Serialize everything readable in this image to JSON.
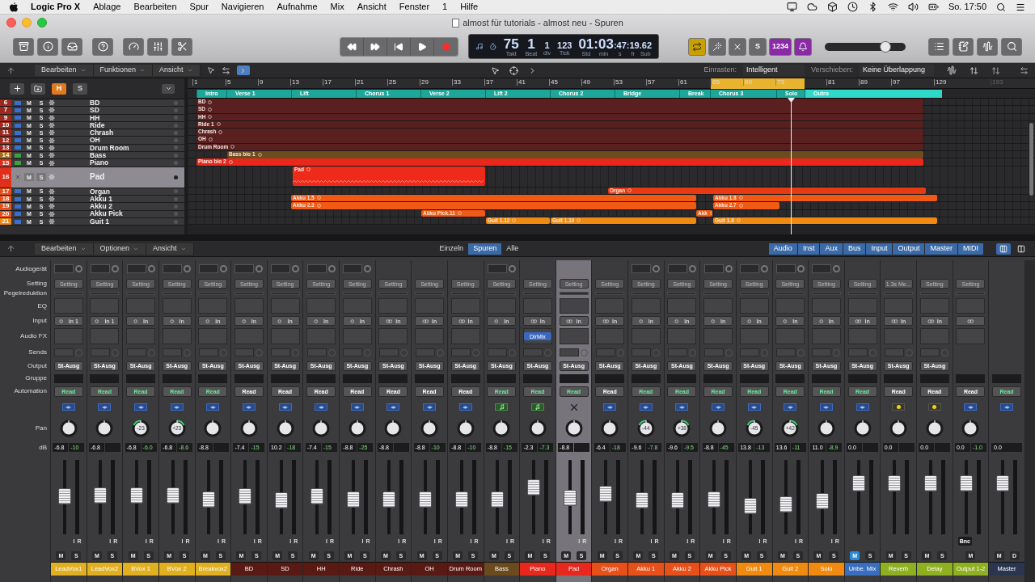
{
  "menu_bar": {
    "app": "Logic Pro X",
    "items": [
      "Ablage",
      "Bearbeiten",
      "Spur",
      "Navigieren",
      "Aufnahme",
      "Mix",
      "Ansicht",
      "Fenster",
      "1",
      "Hilfe"
    ],
    "clock": "So. 17:50"
  },
  "window": {
    "title": "almost für tutorials - almost neu - Spuren"
  },
  "toolbar": {
    "lcd": {
      "fields": [
        {
          "value": "75",
          "label": "Takt",
          "kind": "large"
        },
        {
          "value": "1",
          "label": "Beat",
          "kind": "large"
        },
        {
          "value": "1",
          "label": "div",
          "kind": "small"
        },
        {
          "value": "123",
          "label": "Tick",
          "kind": "small"
        }
      ],
      "time": [
        {
          "value": "01",
          "label": "Std",
          "kind": "large"
        },
        {
          "value": ":03",
          "label": "min",
          "kind": "large"
        },
        {
          "value": ":47",
          "label": "s",
          "kind": "small"
        },
        {
          "value": ":19",
          "label": "fr",
          "kind": "small"
        },
        {
          "value": ".62",
          "label": "Sub",
          "kind": "small"
        }
      ]
    },
    "modes": [
      {
        "kind": "cycle",
        "on": true
      },
      {
        "kind": "tuner",
        "on": false
      },
      {
        "kind": "replace",
        "on": false
      },
      {
        "kind": "solo",
        "label": "S",
        "on": false
      },
      {
        "kind": "count-in",
        "label": "1234",
        "on": true
      },
      {
        "kind": "metronome",
        "on": true
      }
    ],
    "master_volume": {
      "level": 0.75
    }
  },
  "tracks_bar": {
    "menus": [
      "Bearbeiten",
      "Funktionen",
      "Ansicht"
    ],
    "snap": {
      "label": "Einrasten:",
      "value": "Intelligent"
    },
    "drag": {
      "label": "Verschieben:",
      "value": "Keine Überlappung"
    }
  },
  "track_header_buttons": [
    {
      "label": "H",
      "on": true
    },
    {
      "label": "S",
      "on": false
    }
  ],
  "ruler": {
    "cycle_on": true,
    "ticks": [
      {
        "label": "1",
        "dimmed": false
      },
      {
        "label": "5",
        "dimmed": false
      },
      {
        "label": "9",
        "dimmed": false
      },
      {
        "label": "13",
        "dimmed": false
      },
      {
        "label": "17",
        "dimmed": false
      },
      {
        "label": "21",
        "dimmed": false
      },
      {
        "label": "25",
        "dimmed": false
      },
      {
        "label": "29",
        "dimmed": false
      },
      {
        "label": "33",
        "dimmed": false
      },
      {
        "label": "37",
        "dimmed": false
      },
      {
        "label": "41",
        "dimmed": false
      },
      {
        "label": "45",
        "dimmed": false
      },
      {
        "label": "49",
        "dimmed": false
      },
      {
        "label": "53",
        "dimmed": false
      },
      {
        "label": "57",
        "dimmed": false
      },
      {
        "label": "61",
        "dimmed": false
      },
      {
        "label": "65",
        "dimmed": false
      },
      {
        "label": "69",
        "dimmed": false
      },
      {
        "label": "73",
        "dimmed": false
      },
      {
        "label": "81",
        "dimmed": false
      },
      {
        "label": "89",
        "dimmed": false
      },
      {
        "label": "97",
        "dimmed": false
      },
      {
        "label": "129",
        "dimmed": false
      },
      {
        "label": "193",
        "dimmed": true
      }
    ]
  },
  "markers": [
    {
      "label": "Intro",
      "selected": false
    },
    {
      "label": "Verse 1",
      "selected": false
    },
    {
      "label": "Lift",
      "selected": false
    },
    {
      "label": "Chorus 1",
      "selected": false
    },
    {
      "label": "Verse 2",
      "selected": false
    },
    {
      "label": "Lift 2",
      "selected": false
    },
    {
      "label": "Chorus 2",
      "selected": false
    },
    {
      "label": "Bridge",
      "selected": false
    },
    {
      "label": "Break",
      "selected": false
    },
    {
      "label": "Chorus 3",
      "selected": false
    },
    {
      "label": "Solo",
      "selected": false
    },
    {
      "label": "Outro",
      "selected": true
    }
  ],
  "tracks": [
    {
      "number": "6",
      "name": "BD",
      "color": "#9c2a1e",
      "kind": "audio",
      "mute": "M",
      "solo": "S",
      "selected": false,
      "regions": [
        {
          "name": "BD",
          "color": "#5a2020"
        }
      ]
    },
    {
      "number": "7",
      "name": "SD",
      "color": "#9c2a1e",
      "kind": "audio",
      "mute": "M",
      "solo": "S",
      "selected": false,
      "regions": [
        {
          "name": "SD",
          "color": "#5a2020"
        }
      ]
    },
    {
      "number": "9",
      "name": "HH",
      "color": "#9c2a1e",
      "kind": "audio",
      "mute": "M",
      "solo": "S",
      "selected": false,
      "regions": [
        {
          "name": "HH",
          "color": "#5a2020"
        }
      ]
    },
    {
      "number": "10",
      "name": "Ride",
      "color": "#9c2a1e",
      "kind": "audio",
      "mute": "M",
      "solo": "S",
      "selected": false,
      "regions": [
        {
          "name": "Ride 1",
          "color": "#5a2020"
        }
      ]
    },
    {
      "number": "11",
      "name": "Chrash",
      "color": "#9c2a1e",
      "kind": "audio",
      "mute": "M",
      "solo": "S",
      "selected": false,
      "regions": [
        {
          "name": "Chrash",
          "color": "#5a2020"
        }
      ]
    },
    {
      "number": "12",
      "name": "OH",
      "color": "#9c2a1e",
      "kind": "audio",
      "mute": "M",
      "solo": "S",
      "selected": false,
      "regions": [
        {
          "name": "OH",
          "color": "#5a2020"
        }
      ]
    },
    {
      "number": "13",
      "name": "Drum Room",
      "color": "#9c2a1e",
      "kind": "audio",
      "mute": "M",
      "solo": "S",
      "selected": false,
      "regions": [
        {
          "name": "Drum Room",
          "color": "#5a2020"
        }
      ]
    },
    {
      "number": "14",
      "name": "Bass",
      "color": "#a8681c",
      "kind": "midi",
      "mute": "M",
      "solo": "S",
      "selected": false,
      "regions": [
        {
          "name": "Bass bio 1",
          "color": "#6e4c1e"
        }
      ]
    },
    {
      "number": "15",
      "name": "Piano",
      "color": "#e0301c",
      "kind": "midi",
      "mute": "M",
      "solo": "S",
      "selected": false,
      "regions": [
        {
          "name": "Piano bio 2",
          "color": "#e8281c"
        }
      ]
    },
    {
      "number": "16",
      "name": "Pad",
      "color": "#e0301c",
      "kind": "inst",
      "mute": "M",
      "solo": "S",
      "selected": true,
      "regions": [
        {
          "name": "Pad",
          "color": "#f02a1a"
        }
      ]
    },
    {
      "number": "17",
      "name": "Organ",
      "color": "#e6501a",
      "kind": "audio",
      "mute": "M",
      "solo": "S",
      "selected": false,
      "regions": [
        {
          "name": "Organ",
          "color": "#e83a12"
        }
      ]
    },
    {
      "number": "18",
      "name": "Akku 1",
      "color": "#e6501a",
      "kind": "audio",
      "mute": "M",
      "solo": "S",
      "selected": false,
      "regions": [
        {
          "name": "Akku 1.5",
          "color": "#f05a14"
        },
        {
          "name": "Akku 1.8",
          "color": "#f05a14"
        }
      ]
    },
    {
      "number": "19",
      "name": "Akku 2",
      "color": "#e6501a",
      "kind": "audio",
      "mute": "M",
      "solo": "S",
      "selected": false,
      "regions": [
        {
          "name": "Akku 2.3",
          "color": "#f05a14"
        },
        {
          "name": "Akku 2.7",
          "color": "#f05a14"
        }
      ]
    },
    {
      "number": "20",
      "name": "Akku Pick",
      "color": "#e6501a",
      "kind": "audio",
      "mute": "M",
      "solo": "S",
      "selected": false,
      "regions": [
        {
          "name": "Akku Pick.11",
          "color": "#f05a14"
        },
        {
          "name": "Akk",
          "color": "#f05a14"
        }
      ]
    },
    {
      "number": "21",
      "name": "Guit 1",
      "color": "#f08a10",
      "kind": "audio",
      "mute": "M",
      "solo": "S",
      "selected": false,
      "regions": [
        {
          "name": "Guit 1.12",
          "color": "#f08a10"
        },
        {
          "name": "Guit 1.10",
          "color": "#f08a10"
        },
        {
          "name": "Guit 1.8",
          "color": "#f08a10"
        }
      ]
    }
  ],
  "mixer": {
    "menus": [
      "Bearbeiten",
      "Optionen",
      "Ansicht"
    ],
    "scope_tabs": [
      {
        "label": "Einzeln",
        "selected": false
      },
      {
        "label": "Spuren",
        "selected": true
      },
      {
        "label": "Alle",
        "selected": false
      }
    ],
    "filters": [
      {
        "label": "Audio",
        "on": true
      },
      {
        "label": "Inst",
        "on": true
      },
      {
        "label": "Aux",
        "on": true
      },
      {
        "label": "Bus",
        "on": true
      },
      {
        "label": "Input",
        "on": true
      },
      {
        "label": "Output",
        "on": true
      },
      {
        "label": "Master",
        "on": true
      },
      {
        "label": "MIDI",
        "on": true
      }
    ],
    "views": [
      {
        "kind": "strips",
        "selected": true
      },
      {
        "kind": "split",
        "selected": false
      }
    ],
    "row_labels": [
      {
        "kind": "device",
        "text": "Audiogerät"
      },
      {
        "kind": "setting",
        "text": "Setting"
      },
      {
        "kind": "pegel",
        "text": "Pegelreduktion"
      },
      {
        "kind": "eq",
        "text": "EQ"
      },
      {
        "kind": "input",
        "text": "Input"
      },
      {
        "kind": "fx",
        "text": "Audio FX"
      },
      {
        "kind": "sends",
        "text": "Sends"
      },
      {
        "kind": "output",
        "text": "Output"
      },
      {
        "kind": "group",
        "text": "Gruppe"
      },
      {
        "kind": "automation",
        "text": "Automation"
      },
      {
        "kind": "pan",
        "text": "Pan"
      },
      {
        "kind": "db",
        "text": "dB"
      }
    ],
    "strips": [
      {
        "name": "LeadVox1",
        "color": "#e0b020",
        "device": true,
        "kind": "audio",
        "setting": "Setting",
        "stereo": false,
        "input": "In 1",
        "output": "St-Ausg",
        "automation": "Read",
        "automation_on": true,
        "pan_knob": true,
        "volume": "-6.8",
        "peak": "-10",
        "level": 0.52,
        "ir": [
          "I",
          "R"
        ],
        "buttons": [
          {
            "label": "M",
            "on": false
          },
          {
            "label": "S",
            "on": false
          }
        ],
        "selected": false
      },
      {
        "name": "LeadVox2",
        "color": "#e0b020",
        "device": true,
        "kind": "audio",
        "setting": "Setting",
        "stereo": false,
        "input": "In 1",
        "output": "St-Ausg",
        "automation": "Read",
        "automation_on": true,
        "pan_knob": true,
        "volume": "-6.8",
        "level": 0.53,
        "ir": [
          "I",
          "R"
        ],
        "buttons": [
          {
            "label": "M",
            "on": false
          },
          {
            "label": "S",
            "on": false
          }
        ],
        "selected": false
      },
      {
        "name": "BVox 1",
        "color": "#e0b020",
        "device": true,
        "kind": "audio",
        "setting": "Setting",
        "stereo": false,
        "input": "In",
        "output": "St-Ausg",
        "automation": "Read",
        "automation_on": true,
        "pan_knob": true,
        "pan": "-23",
        "pan_right": false,
        "volume": "-6.8",
        "peak": "-6.0",
        "level": 0.53,
        "ir": [
          "I",
          "R"
        ],
        "buttons": [
          {
            "label": "M",
            "on": false
          },
          {
            "label": "S",
            "on": false
          }
        ],
        "selected": false
      },
      {
        "name": "BVox 2",
        "color": "#e0b020",
        "device": true,
        "kind": "audio",
        "setting": "Setting",
        "stereo": false,
        "input": "In",
        "output": "St-Ausg",
        "automation": "Read",
        "automation_on": true,
        "pan_knob": true,
        "pan": "+23",
        "pan_right": true,
        "volume": "-6.8",
        "peak": "-8.6",
        "level": 0.53,
        "ir": [
          "I",
          "R"
        ],
        "buttons": [
          {
            "label": "M",
            "on": false
          },
          {
            "label": "S",
            "on": false
          }
        ],
        "selected": false
      },
      {
        "name": "Breakvox2",
        "color": "#e0b020",
        "device": true,
        "kind": "audio",
        "setting": "Setting",
        "stereo": false,
        "input": "In",
        "output": "St-Ausg",
        "automation": "Read",
        "automation_on": true,
        "pan_knob": true,
        "volume": "-8.8",
        "level": 0.46,
        "ir": [
          "I",
          "R"
        ],
        "buttons": [
          {
            "label": "M",
            "on": false
          },
          {
            "label": "S",
            "on": false
          }
        ],
        "selected": false
      },
      {
        "name": "BD",
        "color": "#5a1a14",
        "device": true,
        "kind": "audio",
        "setting": "Setting",
        "stereo": false,
        "input": "In",
        "output": "St-Ausg",
        "automation": "Read",
        "automation_on": false,
        "pan_knob": true,
        "volume": "-7.4",
        "peak": "-15",
        "level": 0.52,
        "ir": [
          "I",
          "R"
        ],
        "buttons": [
          {
            "label": "M",
            "on": false
          },
          {
            "label": "S",
            "on": false
          }
        ],
        "selected": false
      },
      {
        "name": "SD",
        "color": "#5a1a14",
        "device": true,
        "kind": "audio",
        "setting": "Setting",
        "stereo": false,
        "input": "In",
        "output": "St-Ausg",
        "automation": "Read",
        "automation_on": false,
        "pan_knob": true,
        "volume": "10.2",
        "peak": "-18",
        "level": 0.44,
        "ir": [
          "I",
          "R"
        ],
        "buttons": [
          {
            "label": "M",
            "on": false
          },
          {
            "label": "S",
            "on": false
          }
        ],
        "selected": false
      },
      {
        "name": "HH",
        "color": "#5a1a14",
        "device": true,
        "kind": "audio",
        "setting": "Setting",
        "stereo": false,
        "input": "In",
        "output": "St-Ausg",
        "automation": "Read",
        "automation_on": false,
        "pan_knob": true,
        "volume": "-7.4",
        "peak": "-15",
        "level": 0.52,
        "ir": [
          "I",
          "R"
        ],
        "buttons": [
          {
            "label": "M",
            "on": false
          },
          {
            "label": "S",
            "on": false
          }
        ],
        "selected": false
      },
      {
        "name": "Ride",
        "color": "#5a1a14",
        "device": true,
        "kind": "audio",
        "setting": "Setting",
        "stereo": false,
        "input": "In",
        "output": "St-Ausg",
        "automation": "Read",
        "automation_on": false,
        "pan_knob": true,
        "volume": "-8.8",
        "peak": "-25",
        "level": 0.46,
        "ir": [
          "I",
          "R"
        ],
        "buttons": [
          {
            "label": "M",
            "on": false
          },
          {
            "label": "S",
            "on": false
          }
        ],
        "selected": false
      },
      {
        "name": "Chrash",
        "color": "#5a1a14",
        "device": false,
        "kind": "audio",
        "setting": "Setting",
        "stereo": true,
        "input": "In",
        "output": "St-Ausg",
        "automation": "Read",
        "automation_on": false,
        "pan_knob": true,
        "volume": "-8.8",
        "level": 0.46,
        "ir": [
          "I",
          "R"
        ],
        "buttons": [
          {
            "label": "M",
            "on": false
          },
          {
            "label": "S",
            "on": false
          }
        ],
        "selected": false
      },
      {
        "name": "OH",
        "color": "#5a1a14",
        "device": false,
        "kind": "audio",
        "setting": "Setting",
        "stereo": true,
        "input": "In",
        "output": "St-Ausg",
        "automation": "Read",
        "automation_on": false,
        "pan_knob": true,
        "volume": "-8.8",
        "peak": "-10",
        "level": 0.46,
        "ir": [
          "I",
          "R"
        ],
        "buttons": [
          {
            "label": "M",
            "on": false
          },
          {
            "label": "S",
            "on": false
          }
        ],
        "selected": false
      },
      {
        "name": "Drum Room",
        "color": "#5a1a14",
        "device": false,
        "kind": "audio",
        "setting": "Setting",
        "stereo": true,
        "input": "In",
        "output": "St-Ausg",
        "automation": "Read",
        "automation_on": false,
        "pan_knob": true,
        "volume": "-8.8",
        "peak": "-10",
        "level": 0.46,
        "ir": [
          "I",
          "R"
        ],
        "buttons": [
          {
            "label": "M",
            "on": false
          },
          {
            "label": "S",
            "on": false
          }
        ],
        "selected": false
      },
      {
        "name": "Bass",
        "color": "#6b4a1e",
        "device": true,
        "kind": "midi",
        "setting": "Setting",
        "stereo": false,
        "input": "In",
        "output": "St-Ausg",
        "automation": "Read",
        "automation_on": true,
        "pan_knob": true,
        "volume": "-8.8",
        "peak": "-15",
        "level": 0.46,
        "ir": [
          "I",
          "R"
        ],
        "buttons": [
          {
            "label": "M",
            "on": false
          },
          {
            "label": "S",
            "on": false
          }
        ],
        "selected": false
      },
      {
        "name": "Piano",
        "color": "#e8281c",
        "device": false,
        "kind": "midi",
        "setting": "Setting",
        "stereo": true,
        "input": "In",
        "fx": "DirMix",
        "output": "St-Ausg",
        "automation": "Read",
        "automation_on": true,
        "pan_knob": true,
        "volume": "-2.3",
        "peak": "-7.3",
        "level": 0.66,
        "ir": [
          "I",
          "R"
        ],
        "buttons": [
          {
            "label": "M",
            "on": false
          },
          {
            "label": "S",
            "on": false
          }
        ],
        "selected": false
      },
      {
        "name": "Pad",
        "color": "#e8281c",
        "device": false,
        "kind": "inst",
        "setting": "Setting",
        "stereo": true,
        "input": "In",
        "output": "St-Ausg",
        "automation": "Read",
        "automation_on": true,
        "pan_knob": true,
        "volume": "-8.8",
        "level": 0.48,
        "ir": [
          "I",
          "R"
        ],
        "buttons": [
          {
            "label": "M",
            "on": false
          },
          {
            "label": "S",
            "on": false
          }
        ],
        "selected": true
      },
      {
        "name": "Organ",
        "color": "#e8501a",
        "device": false,
        "kind": "audio",
        "setting": "Setting",
        "stereo": true,
        "input": "In",
        "output": "St-Ausg",
        "automation": "Read",
        "automation_on": false,
        "pan_knob": true,
        "volume": "-6.4",
        "peak": "-18",
        "level": 0.55,
        "ir": [
          "I",
          "R"
        ],
        "buttons": [
          {
            "label": "M",
            "on": false
          },
          {
            "label": "S",
            "on": false
          }
        ],
        "selected": false
      },
      {
        "name": "Akku 1",
        "color": "#e8501a",
        "device": true,
        "kind": "audio",
        "setting": "Setting",
        "stereo": false,
        "input": "In",
        "output": "St-Ausg",
        "automation": "Read",
        "automation_on": true,
        "pan_knob": true,
        "pan": "-44",
        "pan_right": false,
        "volume": "-9.6",
        "peak": "-7.8",
        "level": 0.45,
        "ir": [
          "I",
          "R"
        ],
        "buttons": [
          {
            "label": "M",
            "on": false
          },
          {
            "label": "S",
            "on": false
          }
        ],
        "selected": false
      },
      {
        "name": "Akku 2",
        "color": "#e8501a",
        "device": true,
        "kind": "audio",
        "setting": "Setting",
        "stereo": false,
        "input": "In",
        "output": "St-Ausg",
        "automation": "Read",
        "automation_on": true,
        "pan_knob": true,
        "pan": "+38",
        "pan_right": true,
        "volume": "-9.6",
        "peak": "-9.5",
        "level": 0.45,
        "ir": [
          "I",
          "R"
        ],
        "buttons": [
          {
            "label": "M",
            "on": false
          },
          {
            "label": "S",
            "on": false
          }
        ],
        "selected": false
      },
      {
        "name": "Akku Pick",
        "color": "#e8501a",
        "device": true,
        "kind": "audio",
        "setting": "Setting",
        "stereo": false,
        "input": "In",
        "output": "St-Ausg",
        "automation": "Read",
        "automation_on": true,
        "pan_knob": true,
        "volume": "-8.8",
        "peak": "-45",
        "level": 0.46,
        "ir": [
          "I",
          "R"
        ],
        "buttons": [
          {
            "label": "M",
            "on": false
          },
          {
            "label": "S",
            "on": false
          }
        ],
        "selected": false
      },
      {
        "name": "Guit 1",
        "color": "#f08a10",
        "device": true,
        "kind": "audio",
        "setting": "Setting",
        "stereo": false,
        "input": "In",
        "output": "St-Ausg",
        "automation": "Read",
        "automation_on": true,
        "pan_knob": true,
        "pan": "-45",
        "pan_right": false,
        "volume": "13.8",
        "peak": "-13",
        "level": 0.35,
        "ir": [
          "I",
          "R"
        ],
        "buttons": [
          {
            "label": "M",
            "on": false
          },
          {
            "label": "S",
            "on": false
          }
        ],
        "selected": false
      },
      {
        "name": "Guit 2",
        "color": "#f08a10",
        "device": true,
        "kind": "audio",
        "setting": "Setting",
        "stereo": false,
        "input": "In",
        "output": "St-Ausg",
        "automation": "Read",
        "automation_on": true,
        "pan_knob": true,
        "pan": "+42",
        "pan_right": true,
        "volume": "13.6",
        "peak": "-11",
        "level": 0.38,
        "ir": [
          "I",
          "R"
        ],
        "buttons": [
          {
            "label": "M",
            "on": false
          },
          {
            "label": "S",
            "on": false
          }
        ],
        "selected": false
      },
      {
        "name": "Solo",
        "color": "#f08a10",
        "device": true,
        "kind": "audio",
        "setting": "Setting",
        "stereo": false,
        "input": "In",
        "output": "St-Ausg",
        "automation": "Read",
        "automation_on": true,
        "pan_knob": true,
        "volume": "11.0",
        "peak": "-8.9",
        "level": 0.43,
        "ir": [
          "I",
          "R"
        ],
        "buttons": [
          {
            "label": "M",
            "on": false
          },
          {
            "label": "S",
            "on": false
          }
        ],
        "selected": false
      },
      {
        "name": "Unbe. Mix",
        "color": "#3a6fc0",
        "device": false,
        "kind": "audio",
        "setting": "Setting",
        "stereo": true,
        "input": "In",
        "output": "St-Ausg",
        "automation": "Read",
        "automation_on": true,
        "pan_knob": true,
        "volume": "0.0",
        "level": 0.73,
        "buttons": [
          {
            "label": "M",
            "on": true
          },
          {
            "label": "S",
            "on": false
          }
        ],
        "selected": false
      },
      {
        "name": "Reverb",
        "color": "#8fb020",
        "device": false,
        "kind": "aux",
        "setting": "1.3s Me...",
        "stereo": true,
        "input": "In",
        "output": "St-Ausg",
        "automation": "Read",
        "automation_on": false,
        "pan_knob": true,
        "volume": "0.0",
        "level": 0.73,
        "buttons": [
          {
            "label": "M",
            "on": false
          },
          {
            "label": "S",
            "on": false
          }
        ],
        "selected": false
      },
      {
        "name": "Delay",
        "color": "#8fb020",
        "device": false,
        "kind": "aux",
        "setting": "Setting",
        "stereo": true,
        "input": "In",
        "output": "St-Ausg",
        "automation": "Read",
        "automation_on": false,
        "pan_knob": true,
        "volume": "0.0",
        "level": 0.73,
        "buttons": [
          {
            "label": "M",
            "on": false
          },
          {
            "label": "S",
            "on": false
          }
        ],
        "selected": false
      },
      {
        "name": "Output 1-2",
        "color": "#8fb020",
        "device": false,
        "kind": "audio",
        "setting": "Setting",
        "stereo": true,
        "automation": "Read",
        "automation_on": false,
        "pan_knob": true,
        "volume": "0.0",
        "peak": "-1.0",
        "level": 0.73,
        "bounce": "Bnc",
        "buttons": [
          {
            "label": "M",
            "on": false
          }
        ],
        "selected": false
      },
      {
        "name": "Master",
        "color": "#2a3650",
        "device": false,
        "kind": "master",
        "automation": "Read",
        "automation_on": true,
        "pan_knob": false,
        "volume": "0.0",
        "level": 0.73,
        "buttons": [
          {
            "label": "M",
            "on": false
          },
          {
            "label": "D",
            "on": false
          }
        ],
        "selected": false
      }
    ]
  }
}
